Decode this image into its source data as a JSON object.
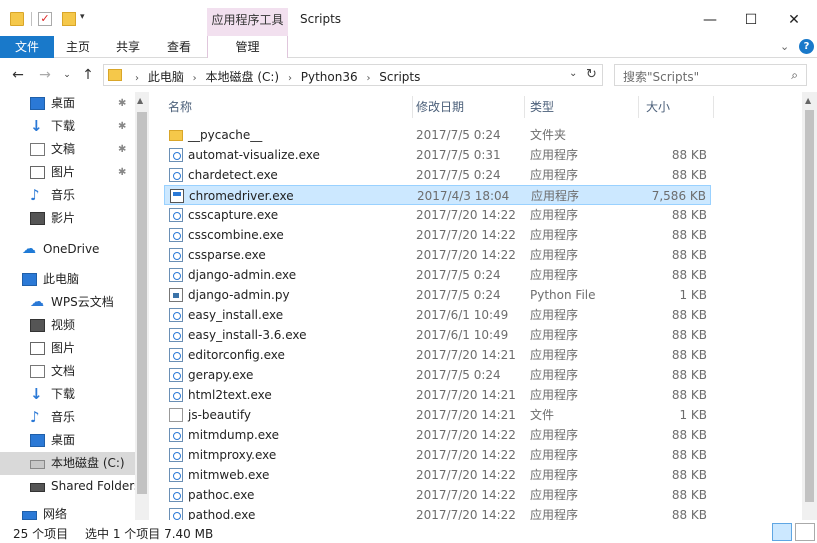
{
  "window": {
    "title": "Scripts",
    "context_tab_header": "应用程序工具",
    "minimize": "—",
    "maximize": "☐",
    "close": "✕"
  },
  "ribbon": {
    "tabs": [
      "文件",
      "主页",
      "共享",
      "查看",
      "管理"
    ],
    "collapse": "⌄",
    "help": "?"
  },
  "address": {
    "breadcrumbs": [
      "此电脑",
      "本地磁盘 (C:)",
      "Python36",
      "Scripts"
    ],
    "search_placeholder": "搜索\"Scripts\""
  },
  "nav": {
    "items": [
      {
        "label": "桌面",
        "icon": "desktop-icon",
        "pinned": true
      },
      {
        "label": "下载",
        "icon": "download-icon",
        "pinned": true
      },
      {
        "label": "文稿",
        "icon": "document-icon",
        "pinned": true
      },
      {
        "label": "图片",
        "icon": "picture-icon",
        "pinned": true
      },
      {
        "label": "音乐",
        "icon": "music-icon",
        "pinned": false
      },
      {
        "label": "影片",
        "icon": "video-icon",
        "pinned": false
      },
      {
        "label": "OneDrive",
        "icon": "onedrive-icon",
        "pinned": false
      },
      {
        "label": "此电脑",
        "icon": "computer-icon",
        "pinned": false
      },
      {
        "label": "WPS云文档",
        "icon": "wps-cloud-icon",
        "pinned": false
      },
      {
        "label": "视频",
        "icon": "video-icon",
        "pinned": false
      },
      {
        "label": "图片",
        "icon": "picture-icon",
        "pinned": false
      },
      {
        "label": "文档",
        "icon": "document-icon",
        "pinned": false
      },
      {
        "label": "下载",
        "icon": "download-icon",
        "pinned": false
      },
      {
        "label": "音乐",
        "icon": "music-icon",
        "pinned": false
      },
      {
        "label": "桌面",
        "icon": "desktop-icon",
        "pinned": false
      },
      {
        "label": "本地磁盘 (C:)",
        "icon": "drive-icon",
        "pinned": false,
        "selected": true
      },
      {
        "label": "Shared Folders",
        "icon": "shared-folder-icon",
        "pinned": false
      },
      {
        "label": "网络",
        "icon": "network-icon",
        "pinned": false
      }
    ]
  },
  "columns": {
    "name": "名称",
    "date": "修改日期",
    "type": "类型",
    "size": "大小"
  },
  "files": [
    {
      "name": "__pycache__",
      "date": "2017/7/5 0:24",
      "type": "文件夹",
      "size": "",
      "icon": "folder"
    },
    {
      "name": "automat-visualize.exe",
      "date": "2017/7/5 0:31",
      "type": "应用程序",
      "size": "88 KB",
      "icon": "exe"
    },
    {
      "name": "chardetect.exe",
      "date": "2017/7/5 0:24",
      "type": "应用程序",
      "size": "88 KB",
      "icon": "exe"
    },
    {
      "name": "chromedriver.exe",
      "date": "2017/4/3 18:04",
      "type": "应用程序",
      "size": "7,586 KB",
      "icon": "win",
      "selected": true
    },
    {
      "name": "csscapture.exe",
      "date": "2017/7/20 14:22",
      "type": "应用程序",
      "size": "88 KB",
      "icon": "exe"
    },
    {
      "name": "csscombine.exe",
      "date": "2017/7/20 14:22",
      "type": "应用程序",
      "size": "88 KB",
      "icon": "exe"
    },
    {
      "name": "cssparse.exe",
      "date": "2017/7/20 14:22",
      "type": "应用程序",
      "size": "88 KB",
      "icon": "exe"
    },
    {
      "name": "django-admin.exe",
      "date": "2017/7/5 0:24",
      "type": "应用程序",
      "size": "88 KB",
      "icon": "exe"
    },
    {
      "name": "django-admin.py",
      "date": "2017/7/5 0:24",
      "type": "Python File",
      "size": "1 KB",
      "icon": "py"
    },
    {
      "name": "easy_install.exe",
      "date": "2017/6/1 10:49",
      "type": "应用程序",
      "size": "88 KB",
      "icon": "exe"
    },
    {
      "name": "easy_install-3.6.exe",
      "date": "2017/6/1 10:49",
      "type": "应用程序",
      "size": "88 KB",
      "icon": "exe"
    },
    {
      "name": "editorconfig.exe",
      "date": "2017/7/20 14:21",
      "type": "应用程序",
      "size": "88 KB",
      "icon": "exe"
    },
    {
      "name": "gerapy.exe",
      "date": "2017/7/5 0:24",
      "type": "应用程序",
      "size": "88 KB",
      "icon": "exe"
    },
    {
      "name": "html2text.exe",
      "date": "2017/7/20 14:21",
      "type": "应用程序",
      "size": "88 KB",
      "icon": "exe"
    },
    {
      "name": "js-beautify",
      "date": "2017/7/20 14:21",
      "type": "文件",
      "size": "1 KB",
      "icon": "blank"
    },
    {
      "name": "mitmdump.exe",
      "date": "2017/7/20 14:22",
      "type": "应用程序",
      "size": "88 KB",
      "icon": "exe"
    },
    {
      "name": "mitmproxy.exe",
      "date": "2017/7/20 14:22",
      "type": "应用程序",
      "size": "88 KB",
      "icon": "exe"
    },
    {
      "name": "mitmweb.exe",
      "date": "2017/7/20 14:22",
      "type": "应用程序",
      "size": "88 KB",
      "icon": "exe"
    },
    {
      "name": "pathoc.exe",
      "date": "2017/7/20 14:22",
      "type": "应用程序",
      "size": "88 KB",
      "icon": "exe"
    },
    {
      "name": "pathod.exe",
      "date": "2017/7/20 14:22",
      "type": "应用程序",
      "size": "88 KB",
      "icon": "exe"
    }
  ],
  "status": {
    "count": "25 个项目",
    "selection": "选中 1 个项目  7.40 MB"
  },
  "colors": {
    "file_tab": "#1979ca",
    "context_tab": "#f2e0ef",
    "selection": "#cce8ff"
  }
}
